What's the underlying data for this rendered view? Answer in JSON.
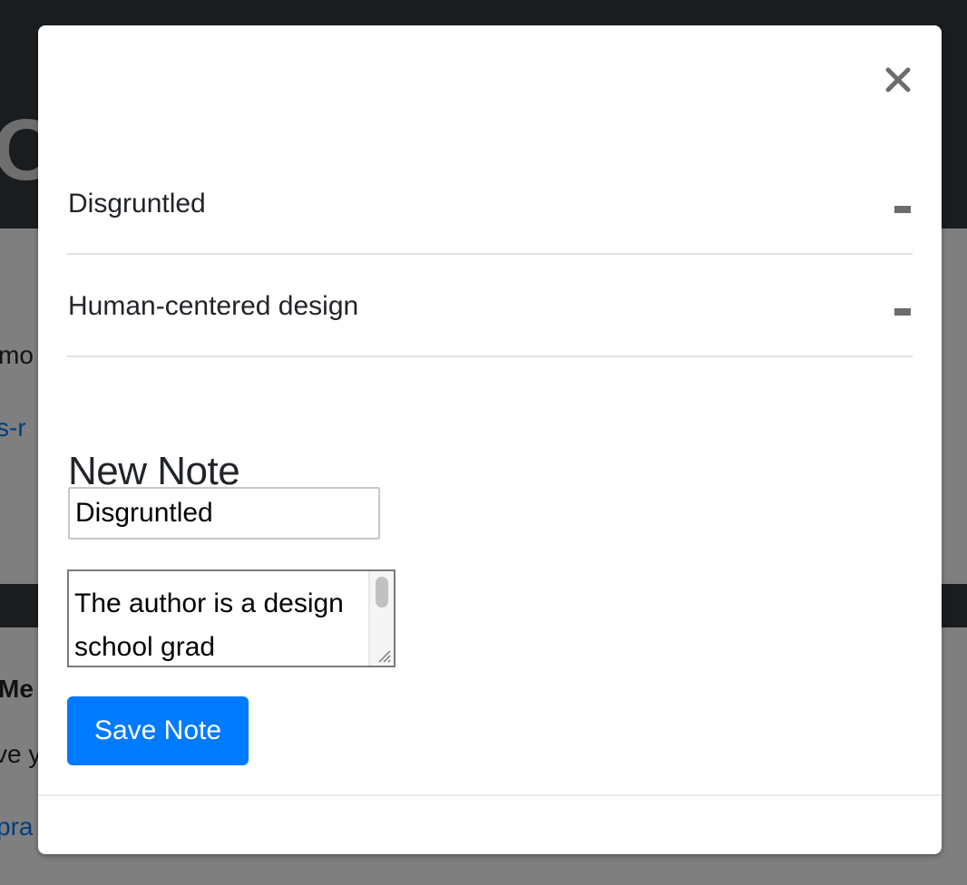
{
  "background": {
    "header_title_fragment": "O",
    "text_fragments": {
      "line1": "mo",
      "link1": "s-r",
      "bold1": "Me",
      "line2": "ve y",
      "link2": "pra"
    }
  },
  "modal": {
    "close_icon": "close-icon",
    "notes": [
      {
        "title": "Disgruntled",
        "remove_icon": "minus-icon"
      },
      {
        "title": "Human-centered design",
        "remove_icon": "minus-icon"
      }
    ],
    "new_note": {
      "heading": "New Note",
      "title_value": "Disgruntled",
      "body_value": "The author is a design school grad",
      "save_label": "Save Note"
    }
  },
  "colors": {
    "primary": "#007bff",
    "dark_header": "#343a40",
    "text": "#212529",
    "divider": "#dee2e6"
  }
}
